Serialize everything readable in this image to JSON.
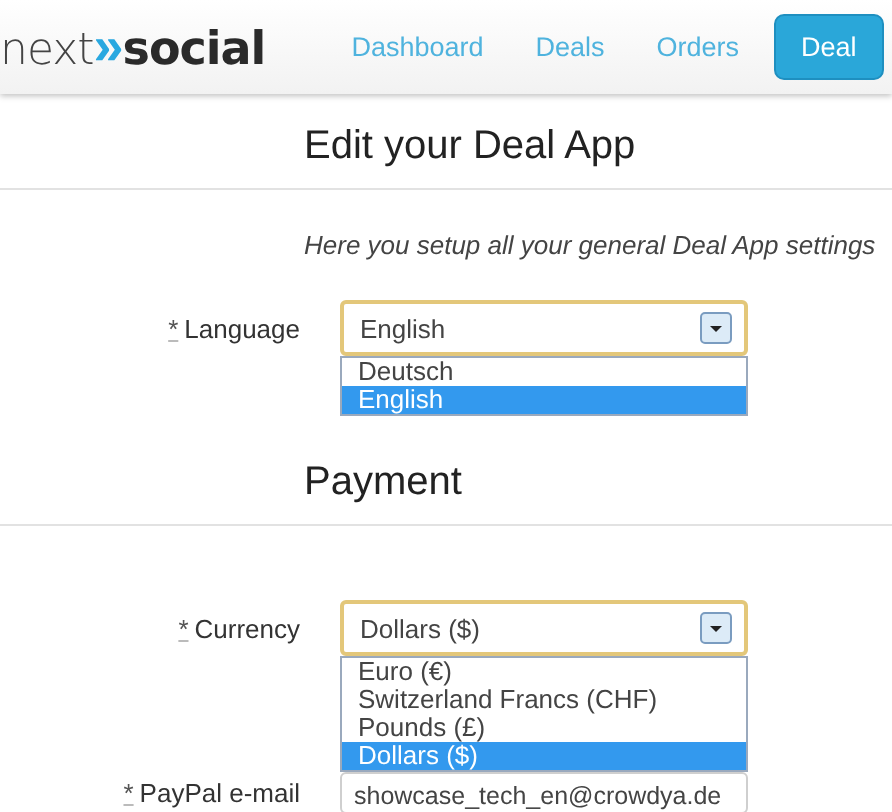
{
  "header": {
    "logo": {
      "parts": [
        {
          "text": "next",
          "kind": "light"
        },
        {
          "text": "»",
          "kind": "accent"
        },
        {
          "text": "social",
          "kind": "bold"
        }
      ]
    },
    "nav": [
      {
        "label": "Dashboard",
        "selected": false
      },
      {
        "label": "Deals",
        "selected": false
      },
      {
        "label": "Orders",
        "selected": false
      },
      {
        "label": "Deal",
        "selected": true
      }
    ]
  },
  "sections": [
    {
      "title": "Edit your Deal App",
      "intro": "Here you setup all your general Deal App settings",
      "fields": [
        {
          "kind": "select",
          "marker": "*",
          "label": "Language",
          "value": "English",
          "expanded": true,
          "options": [
            {
              "label": "Deutsch",
              "selected": false
            },
            {
              "label": "English",
              "selected": true
            }
          ]
        }
      ]
    },
    {
      "title": "Payment",
      "fields": [
        {
          "kind": "select",
          "marker": "*",
          "label": "Currency",
          "value": "Dollars ($)",
          "expanded": true,
          "options": [
            {
              "label": "Euro (€)",
              "selected": false
            },
            {
              "label": "Switzerland Francs (CHF)",
              "selected": false
            },
            {
              "label": "Pounds (£)",
              "selected": false
            },
            {
              "label": "Dollars ($)",
              "selected": true
            }
          ]
        },
        {
          "kind": "text",
          "marker": "*",
          "label": "PayPal e-mail",
          "value": "showcase_tech_en@crowdya.de"
        }
      ]
    }
  ]
}
